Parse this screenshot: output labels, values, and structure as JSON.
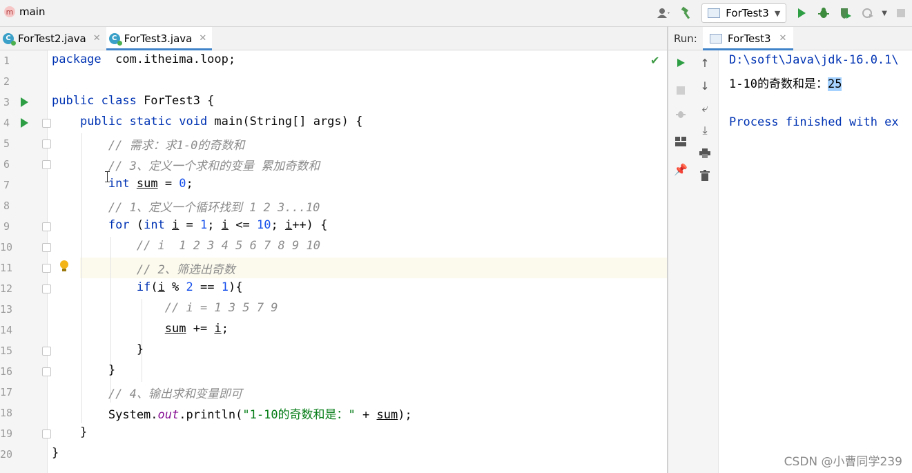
{
  "toolbar": {
    "project_name": "main",
    "run_config": "ForTest3"
  },
  "tabs": [
    {
      "label": "ForTest2.java",
      "active": false
    },
    {
      "label": "ForTest3.java",
      "active": true
    }
  ],
  "editor": {
    "line_numbers": [
      "1",
      "2",
      "3",
      "4",
      "5",
      "6",
      "7",
      "8",
      "9",
      "10",
      "11",
      "12",
      "13",
      "14",
      "15",
      "16",
      "17",
      "18",
      "19",
      "20"
    ],
    "lines": [
      {
        "n": "1",
        "parts": [
          [
            "kw",
            "package"
          ],
          [
            "",
            "  com.itheima.loop;"
          ]
        ]
      },
      {
        "n": "2",
        "parts": []
      },
      {
        "n": "3",
        "parts": [
          [
            "kw",
            "public class"
          ],
          [
            "",
            " ForTest3 {"
          ]
        ]
      },
      {
        "n": "4",
        "parts": [
          [
            "",
            "    "
          ],
          [
            "kw",
            "public static void"
          ],
          [
            "",
            " main(String[] args) {"
          ]
        ]
      },
      {
        "n": "5",
        "parts": [
          [
            "",
            "        "
          ],
          [
            "cm",
            "// 需求：求1-0的奇数和"
          ]
        ]
      },
      {
        "n": "6",
        "parts": [
          [
            "",
            "        "
          ],
          [
            "cm",
            "// 3、定义一个求和的变量 累加奇数和"
          ]
        ]
      },
      {
        "n": "7",
        "parts": [
          [
            "",
            "        "
          ],
          [
            "kw",
            "int"
          ],
          [
            "",
            " "
          ],
          [
            "ul",
            "sum"
          ],
          [
            "",
            " = "
          ],
          [
            "num",
            "0"
          ],
          [
            "",
            ";"
          ]
        ]
      },
      {
        "n": "8",
        "parts": [
          [
            "",
            "        "
          ],
          [
            "cm",
            "// 1、定义一个循环找到 1 2 3...10"
          ]
        ]
      },
      {
        "n": "9",
        "parts": [
          [
            "",
            "        "
          ],
          [
            "kw",
            "for"
          ],
          [
            "",
            " ("
          ],
          [
            "kw",
            "int"
          ],
          [
            "",
            " "
          ],
          [
            "ul",
            "i"
          ],
          [
            "",
            " = "
          ],
          [
            "num",
            "1"
          ],
          [
            "",
            "; "
          ],
          [
            "ul",
            "i"
          ],
          [
            "",
            " <= "
          ],
          [
            "num",
            "10"
          ],
          [
            "",
            "; "
          ],
          [
            "ul",
            "i"
          ],
          [
            "",
            "++) {"
          ]
        ]
      },
      {
        "n": "10",
        "parts": [
          [
            "",
            "            "
          ],
          [
            "cm",
            "// i  1 2 3 4 5 6 7 8 9 10"
          ]
        ]
      },
      {
        "n": "11",
        "parts": [
          [
            "",
            "            "
          ],
          [
            "cm",
            "// 2、筛选出奇数"
          ]
        ]
      },
      {
        "n": "12",
        "parts": [
          [
            "",
            "            "
          ],
          [
            "kw",
            "if"
          ],
          [
            "",
            "("
          ],
          [
            "ul",
            "i"
          ],
          [
            "",
            " % "
          ],
          [
            "num",
            "2"
          ],
          [
            "",
            " == "
          ],
          [
            "num",
            "1"
          ],
          [
            "",
            "){"
          ]
        ]
      },
      {
        "n": "13",
        "parts": [
          [
            "",
            "                "
          ],
          [
            "cm",
            "// i = 1 3 5 7 9"
          ]
        ]
      },
      {
        "n": "14",
        "parts": [
          [
            "",
            "                "
          ],
          [
            "ul",
            "sum"
          ],
          [
            "",
            " += "
          ],
          [
            "ul",
            "i"
          ],
          [
            "",
            ";"
          ]
        ]
      },
      {
        "n": "15",
        "parts": [
          [
            "",
            "            }"
          ]
        ]
      },
      {
        "n": "16",
        "parts": [
          [
            "",
            "        }"
          ]
        ]
      },
      {
        "n": "17",
        "parts": [
          [
            "",
            "        "
          ],
          [
            "cm",
            "// 4、输出求和变量即可"
          ]
        ]
      },
      {
        "n": "18",
        "parts": [
          [
            "",
            "        System."
          ],
          [
            "stat",
            "out"
          ],
          [
            "",
            ".println("
          ],
          [
            "str",
            "\"1-10的奇数和是：\""
          ],
          [
            "",
            " + "
          ],
          [
            "ul",
            "sum"
          ],
          [
            "",
            ");"
          ]
        ]
      },
      {
        "n": "19",
        "parts": [
          [
            "",
            "    }"
          ]
        ]
      },
      {
        "n": "20",
        "parts": [
          [
            "",
            "}"
          ]
        ]
      }
    ]
  },
  "run_panel": {
    "label": "Run:",
    "tab": "ForTest3",
    "console": {
      "path_line": "D:\\soft\\Java\\jdk-16.0.1\\",
      "result_prefix": "1-10的奇数和是：",
      "result_value": "25",
      "finish_line": "Process finished with ex"
    }
  },
  "watermark": "CSDN @小曹同学239",
  "colors": {
    "keyword": "#0033b3",
    "number": "#1750eb",
    "comment": "#8c8c8c",
    "string": "#067d17",
    "run_green": "#2e9e44",
    "tab_underline": "#4083c9"
  }
}
